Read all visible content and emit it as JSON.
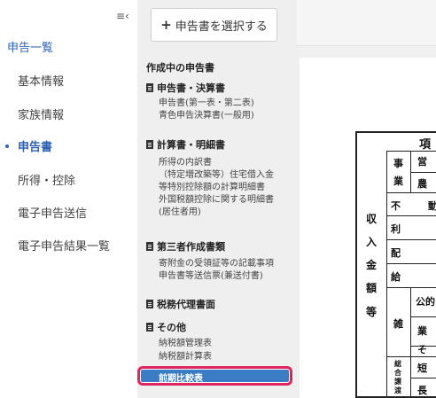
{
  "nav": {
    "collapse_icon": "≡‹",
    "title": "申告一覧",
    "items": [
      {
        "label": "基本情報"
      },
      {
        "label": "家族情報"
      },
      {
        "label": "申告書"
      },
      {
        "label": "所得・控除"
      },
      {
        "label": "電子申告送信"
      },
      {
        "label": "電子申告結果一覧"
      }
    ],
    "active_index": 2
  },
  "panel": {
    "select_button": "申告書を選択する",
    "heading": "作成中の申告書",
    "groups": [
      {
        "title": "申告書・決算書",
        "items": [
          "申告書(第一表・第二表)",
          "青色申告決算書(一般用)"
        ]
      },
      {
        "title": "計算書・明細書",
        "items": [
          "所得の内訳書",
          "（特定増改築等）住宅借入金",
          "等特別控除額の計算明細書",
          "外国税額控除に関する明細書",
          "(居住者用)"
        ]
      },
      {
        "title": "第三者作成書類",
        "items": [
          "寄附金の受領証等の記載事項",
          "申告書等送信票(兼送付書)"
        ]
      },
      {
        "title": "税務代理書面",
        "items": []
      },
      {
        "title": "その他",
        "items": [
          "納税額管理表",
          "納税額計算表",
          "前期比較表"
        ]
      }
    ],
    "selected_item": "前期比較表"
  },
  "form": {
    "header": "項",
    "side_label": [
      "収",
      "入",
      "金",
      "額",
      "等"
    ],
    "business": [
      "事",
      "業"
    ],
    "business_rows": [
      "営",
      "農"
    ],
    "rows": [
      "不",
      "利",
      "配",
      "給"
    ],
    "fudosan_suffix": "動",
    "misc": "雑",
    "misc_rows": [
      "公的",
      "業",
      "そ"
    ],
    "sogo": [
      "総",
      "合",
      "譲",
      "渡"
    ],
    "sogo_rows": [
      "短",
      "長"
    ]
  }
}
